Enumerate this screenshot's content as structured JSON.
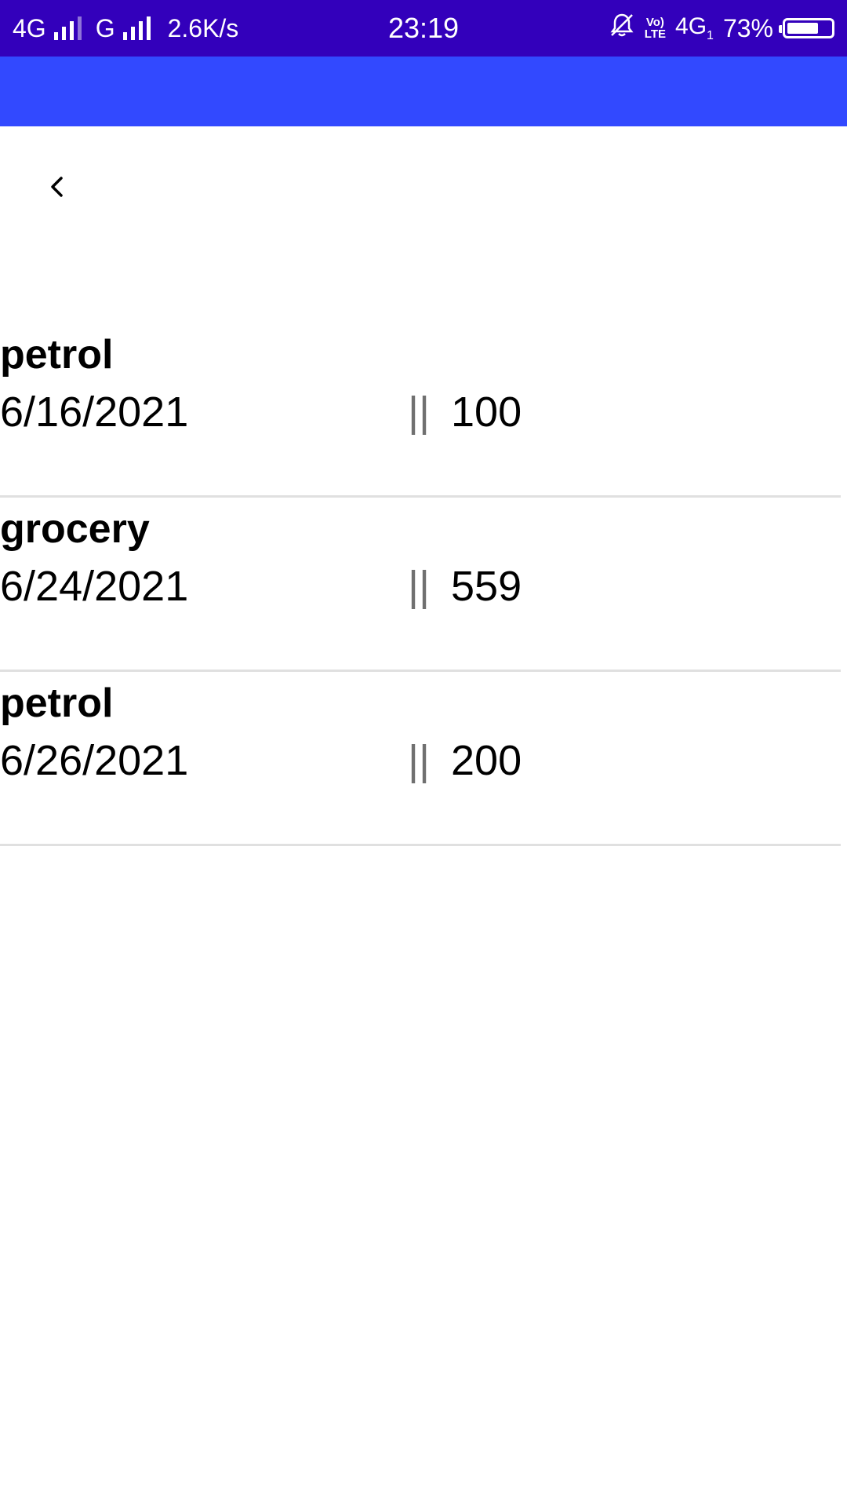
{
  "status_bar": {
    "network1": "4G",
    "network2": "G",
    "speed": "2.6K/s",
    "time": "23:19",
    "volte_top": "Vo)",
    "volte_bottom": "LTE",
    "network3": "4G",
    "network3_sub": "1",
    "battery_percent": "73%",
    "battery_level": 0.73,
    "icons": [
      "signal-icon",
      "mute-alarm-icon",
      "battery-icon"
    ]
  },
  "colors": {
    "status_bar": "#3300bb",
    "app_bar": "#3249ff",
    "divider": "#e0e0e0",
    "separator": "#707070"
  },
  "nav": {
    "back_icon": "chevron-left-icon"
  },
  "expenses": [
    {
      "name": "petrol",
      "date": "6/16/2021",
      "separator": "||",
      "amount": "100"
    },
    {
      "name": "grocery",
      "date": "6/24/2021",
      "separator": "||",
      "amount": "559"
    },
    {
      "name": "petrol",
      "date": "6/26/2021",
      "separator": "||",
      "amount": "200"
    }
  ]
}
